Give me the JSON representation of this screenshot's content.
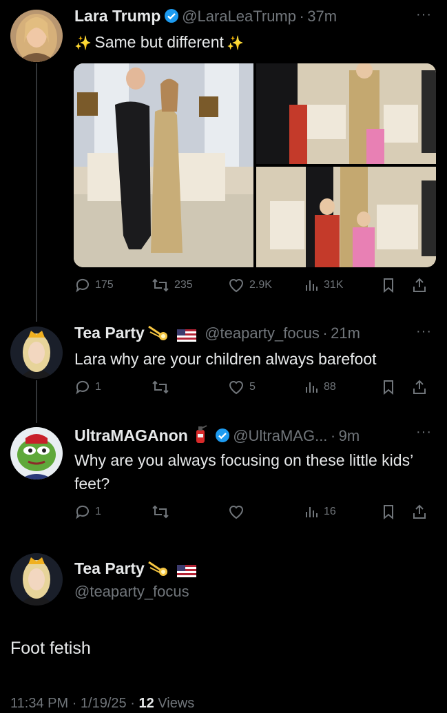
{
  "colors": {
    "background": "#000000",
    "text": "#e7e9ea",
    "muted": "#71767b",
    "verified": "#1d9bf0",
    "line": "#333639"
  },
  "tweets": [
    {
      "name": "Lara Trump",
      "handle": "@LaraLeaTrump",
      "time": "37m",
      "text": "Same but different",
      "badges": [
        "verified-icon"
      ],
      "stats": {
        "replies": "175",
        "retweets": "235",
        "likes": "2.9K",
        "views": "31K"
      }
    },
    {
      "name": "Tea Party",
      "handle": "@teaparty_focus",
      "time": "21m",
      "text": "Lara why are your children always barefoot",
      "badges": [
        "comet-icon",
        "us-flag-icon"
      ],
      "stats": {
        "replies": "1",
        "retweets": "",
        "likes": "5",
        "views": "88"
      }
    },
    {
      "name": "UltraMAGAnon",
      "handle": "@UltraMAG...",
      "time": "9m",
      "text": "Why are you always focusing on these little kids’ feet?",
      "badges": [
        "fire-extinguisher-icon",
        "verified-icon"
      ],
      "stats": {
        "replies": "1",
        "retweets": "",
        "likes": "",
        "views": "16"
      }
    }
  ],
  "main_tweet": {
    "name": "Tea Party",
    "handle": "@teaparty_focus",
    "text": "Foot fetish",
    "time": "11:34 PM",
    "date": "1/19/25",
    "views_count": "12",
    "views_label": "Views"
  },
  "sep": "·",
  "more_label": "···"
}
